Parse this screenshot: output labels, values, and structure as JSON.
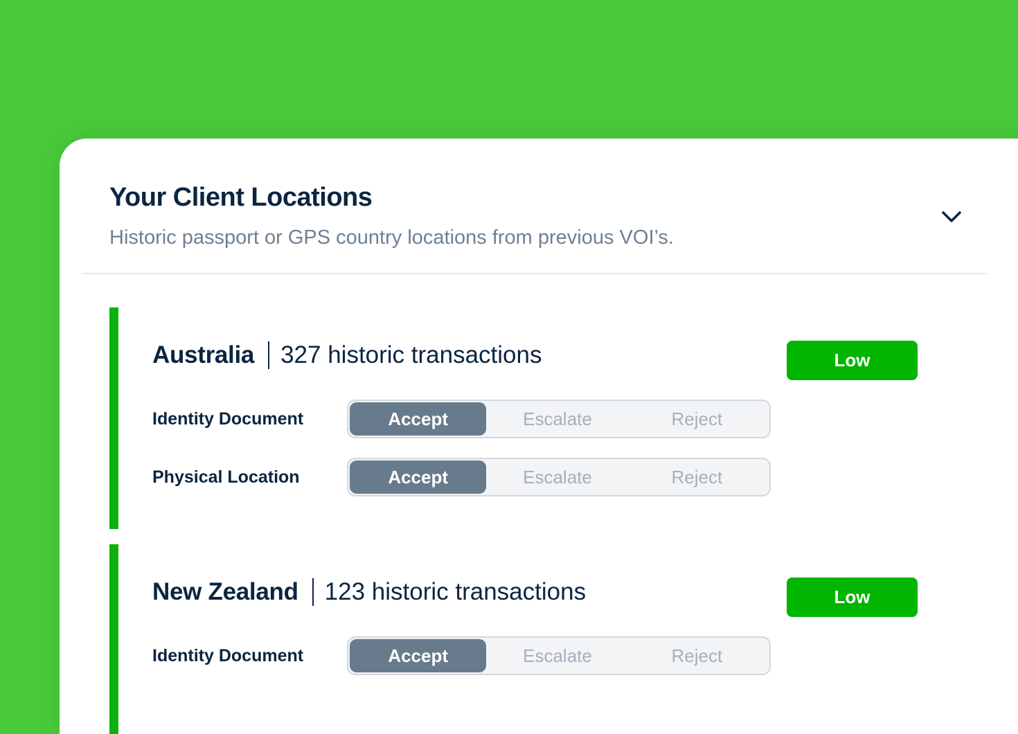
{
  "colors": {
    "background": "#48C93A",
    "accent_bar": "#0DB10D",
    "risk_low": "#01B501",
    "segment_active": "#687B8C",
    "heading": "#0B2541"
  },
  "panel": {
    "title": "Your Client Locations",
    "subtitle": "Historic passport or GPS country locations from previous VOI’s.",
    "toggle_icon": "chevron-down-icon"
  },
  "segment_options": [
    "Accept",
    "Escalate",
    "Reject"
  ],
  "locations": [
    {
      "country": "Australia",
      "transactions": "327 historic transactions",
      "risk": "Low",
      "checks": [
        {
          "label": "Identity Document",
          "selected": "Accept"
        },
        {
          "label": "Physical Location",
          "selected": "Accept"
        }
      ]
    },
    {
      "country": "New Zealand",
      "transactions": "123 historic transactions",
      "risk": "Low",
      "checks": [
        {
          "label": "Identity Document",
          "selected": "Accept"
        }
      ]
    }
  ]
}
